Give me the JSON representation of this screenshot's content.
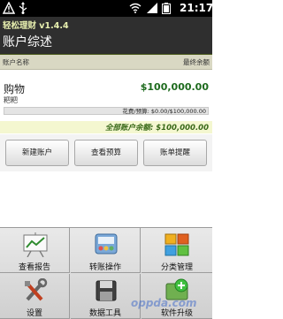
{
  "status_bar": {
    "time": "21:17"
  },
  "app": {
    "name": "轻松理财 v1.4.4",
    "page_title": "账户综述"
  },
  "columns": {
    "left": "账户名称",
    "right": "最终余额"
  },
  "account": {
    "name": "购物",
    "sub": "粑粑",
    "amount": "$100,000.00",
    "budget_label": "花费/预算: $0.00/$100,000.00",
    "spent_fraction": 0.0
  },
  "total": {
    "text": "全部账户余额: $100,000.00"
  },
  "buttons": {
    "new_account": "新建账户",
    "view_budget": "查看预算",
    "bill_reminder": "账单提醒"
  },
  "menu": {
    "items": [
      {
        "label": "查看报告",
        "icon": "report-chart-icon"
      },
      {
        "label": "转账操作",
        "icon": "transfer-icon"
      },
      {
        "label": "分类管理",
        "icon": "category-icon"
      },
      {
        "label": "设置",
        "icon": "settings-tools-icon"
      },
      {
        "label": "数据工具",
        "icon": "data-tools-icon"
      },
      {
        "label": "软件升级",
        "icon": "upgrade-icon"
      }
    ]
  },
  "watermark": "oppda.com"
}
